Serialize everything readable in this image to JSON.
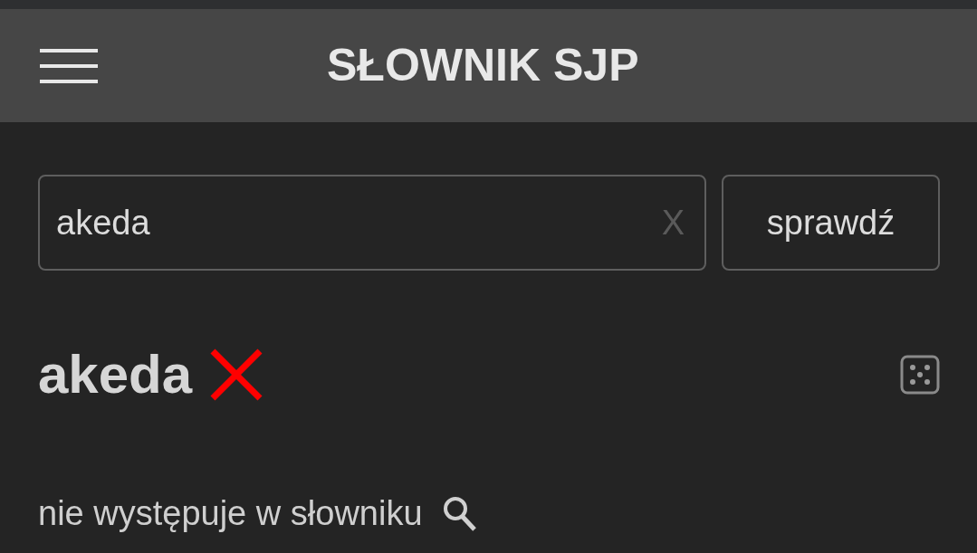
{
  "header": {
    "title": "SŁOWNIK SJP"
  },
  "search": {
    "value": "akeda",
    "clear_label": "X"
  },
  "check_button": {
    "label": "sprawdź"
  },
  "result": {
    "word": "akeda",
    "found": false,
    "status": "nie występuje w słowniku"
  }
}
